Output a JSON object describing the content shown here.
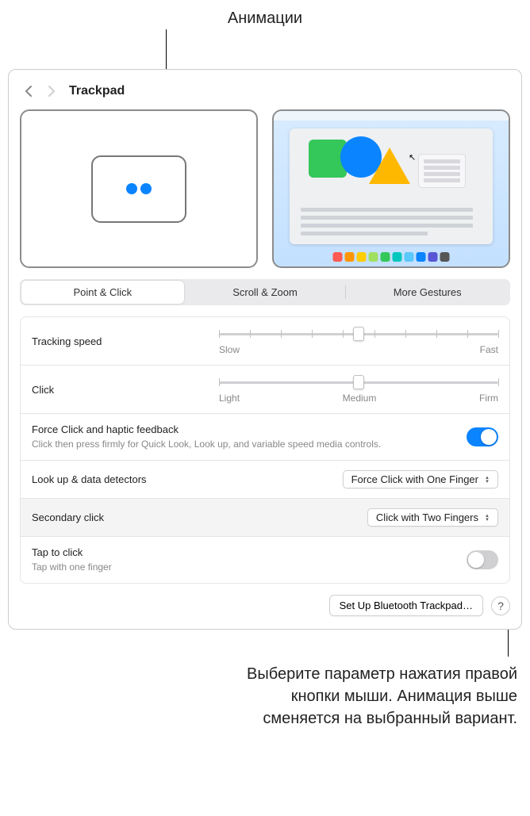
{
  "annotations": {
    "top": "Анимации",
    "bottom_line1": "Выберите параметр нажатия правой",
    "bottom_line2": "кнопки мыши. Анимация выше",
    "bottom_line3": "сменяется на выбранный вариант."
  },
  "title": "Trackpad",
  "tabs": {
    "point_click": "Point & Click",
    "scroll_zoom": "Scroll & Zoom",
    "more_gestures": "More Gestures"
  },
  "tracking": {
    "label": "Tracking speed",
    "low": "Slow",
    "high": "Fast",
    "value_pct": 50,
    "tick_count": 10
  },
  "click": {
    "label": "Click",
    "low": "Light",
    "mid": "Medium",
    "high": "Firm",
    "value_pct": 50,
    "tick_count": 3
  },
  "force_click": {
    "label": "Force Click and haptic feedback",
    "sub": "Click then press firmly for Quick Look, Look up, and variable speed media controls.",
    "on": true
  },
  "lookup": {
    "label": "Look up & data detectors",
    "value": "Force Click with One Finger"
  },
  "secondary": {
    "label": "Secondary click",
    "value": "Click with Two Fingers"
  },
  "tap": {
    "label": "Tap to click",
    "sub": "Tap with one finger",
    "on": false
  },
  "footer": {
    "setup": "Set Up Bluetooth Trackpad…",
    "help": "?"
  },
  "dock_colors": [
    "#ff5a52",
    "#ff9500",
    "#ffcc00",
    "#a0e060",
    "#34c759",
    "#00c7be",
    "#5ac8fa",
    "#0a84ff",
    "#5856d6",
    "#565656"
  ]
}
